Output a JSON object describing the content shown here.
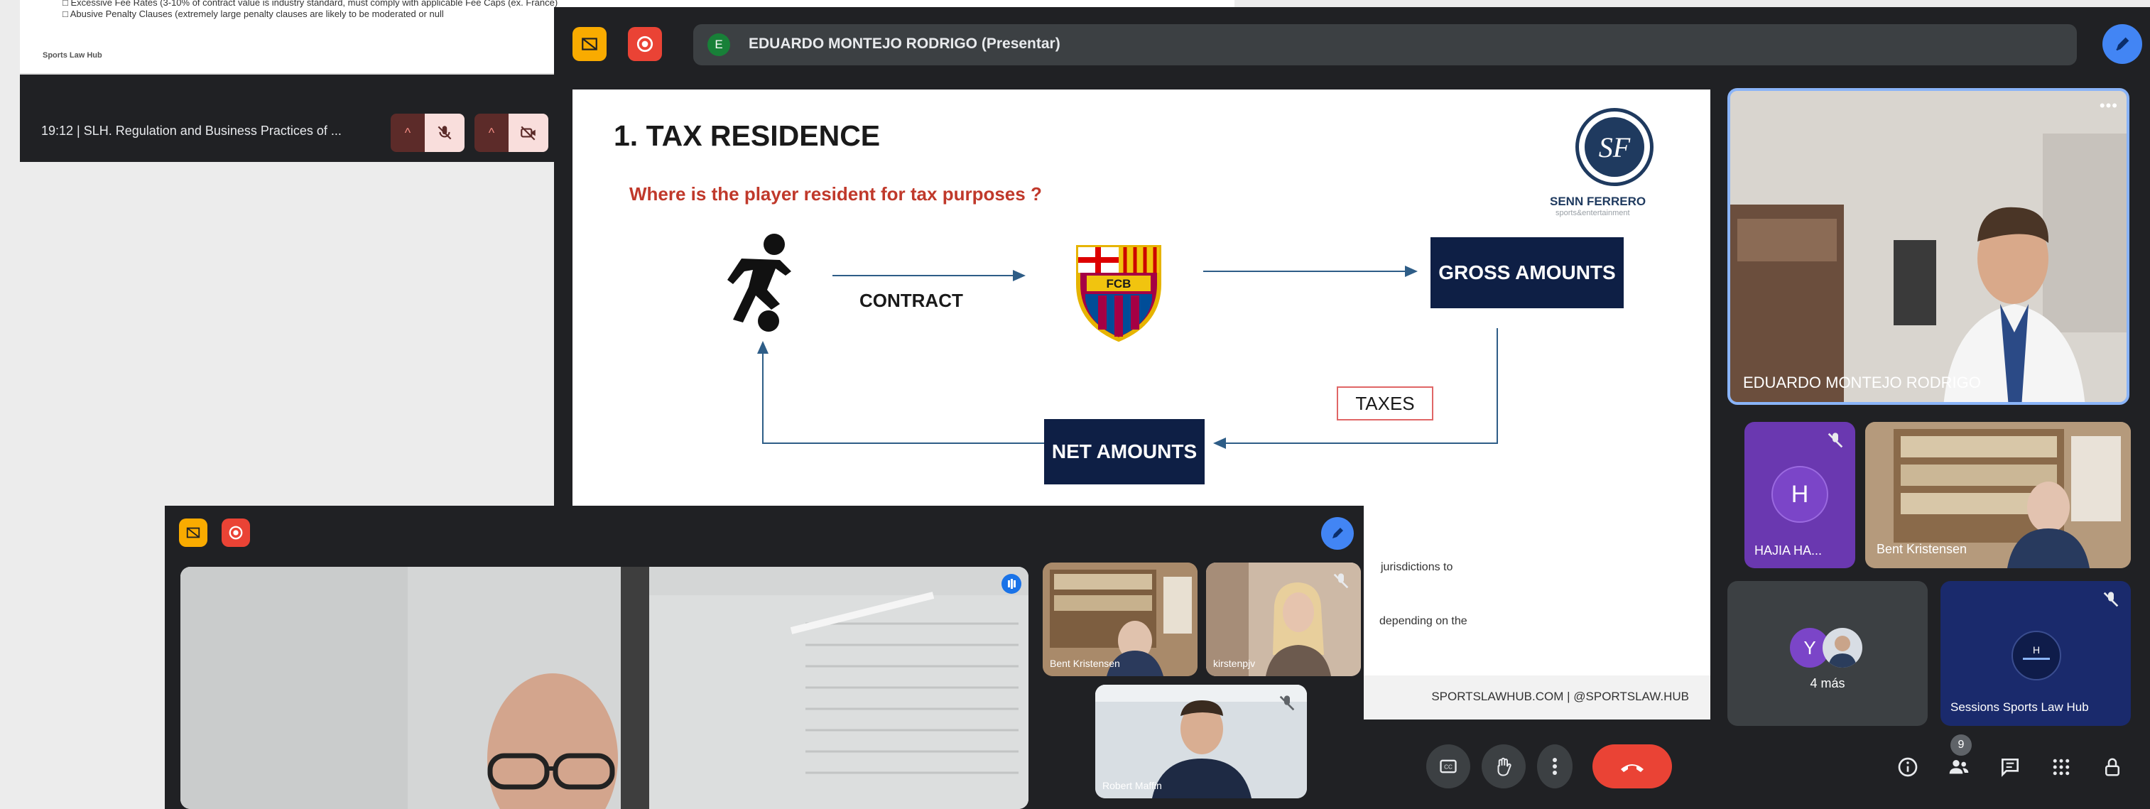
{
  "window1": {
    "doc_lines": [
      "□  Excessive Fee Rates (3-10% of contract value is industry standard, must comply with applicable Fee Caps (ex. France)",
      "□  Abusive Penalty Clauses (extremely large penalty clauses are likely to be moderated or null"
    ],
    "doc_logo": "Sports Law Hub",
    "meeting_title": "19:12  |  SLH. Regulation and Business Practices of ..."
  },
  "window2": {
    "presenter_avatar": "E",
    "presenter_text": "EDUARDO MONTEJO RODRIGO (Presentar)",
    "slide": {
      "title": "1. TAX RESIDENCE",
      "subtitle": "Where is the player resident for tax purposes ?",
      "logo_mark": "SF",
      "logo_name": "SENN FERRERO",
      "logo_sub": "sports&entertainment",
      "contract_label": "CONTRACT",
      "club_letters": "FCB",
      "gross_box": "GROSS AMOUNTS",
      "net_box": "NET AMOUNTS",
      "taxes_label": "TAXES",
      "fragment_1": "jurisdictions to",
      "fragment_2": "depending on the",
      "footer": "SPORTSLAWHUB.COM | @SPORTSLAW.HUB"
    },
    "tiles": {
      "speaker": "EDUARDO MONTEJO RODRIGO",
      "hajia_initial": "H",
      "hajia": "HAJIA HA...",
      "bent": "Bent Kristensen",
      "more_initial": "Y",
      "more": "4 más",
      "sessions": "Sessions Sports Law Hub"
    },
    "people_count": "9"
  },
  "window3": {
    "tiles": {
      "bent": "Bent Kristensen",
      "kirsten": "kirstenpjv",
      "robert": "Robert Maffin"
    }
  },
  "colors": {
    "meet_dark": "#202124",
    "meet_tile": "#3c4043",
    "hangup_red": "#ea4335",
    "accent_blue": "#4285f4",
    "slide_navy": "#0e1f45",
    "subtitle_red": "#c0392b"
  }
}
